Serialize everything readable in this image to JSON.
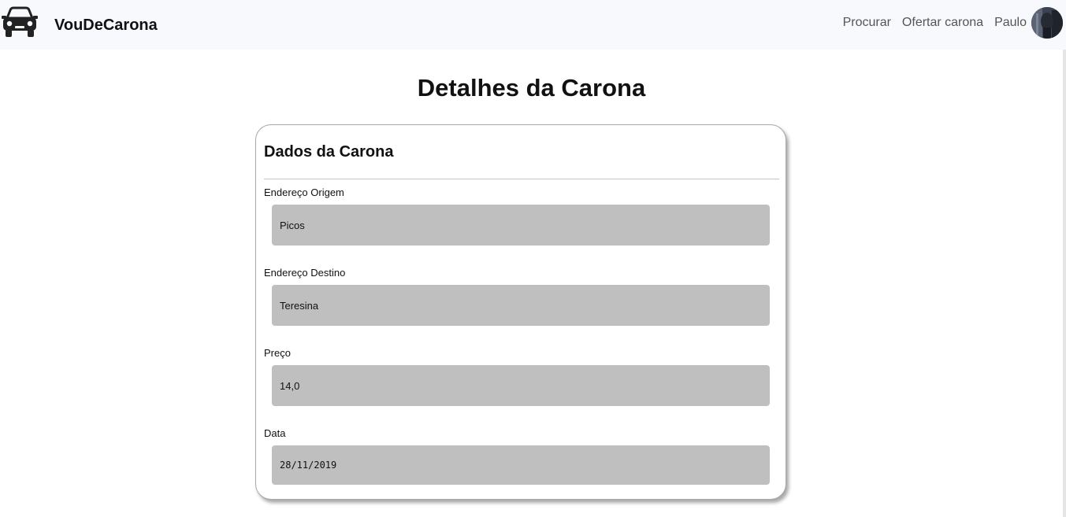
{
  "navbar": {
    "brand_name": "VouDeCarona",
    "links": [
      "Procurar",
      "Ofertar carona"
    ],
    "user_name": "Paulo"
  },
  "page": {
    "title": "Detalhes da Carona"
  },
  "card": {
    "title": "Dados da Carona",
    "fields": [
      {
        "label": "Endereço Origem",
        "value": "Picos"
      },
      {
        "label": "Endereço Destino",
        "value": "Teresina"
      },
      {
        "label": "Preço",
        "value": "14,0"
      },
      {
        "label": "Data",
        "value": "28/11/2019"
      }
    ]
  },
  "colors": {
    "navbar_bg": "#f8f9fc",
    "input_bg": "#bfbfbf",
    "text": "#111111",
    "nav_link": "#555555"
  }
}
